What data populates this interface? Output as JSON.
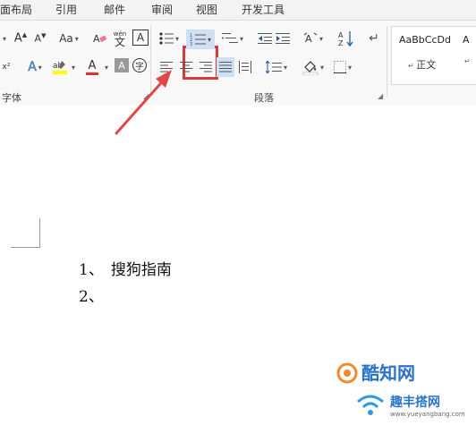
{
  "ribbon": {
    "tabs": [
      "面布局",
      "引用",
      "邮件",
      "审阅",
      "视图",
      "开发工具"
    ],
    "font_group": {
      "label": "字体",
      "wen_label_top": "wén",
      "wen_label_bottom": "文",
      "char_border": "A",
      "char_shading": "A",
      "enclosed_char": "字"
    },
    "paragraph_group": {
      "label": "段落"
    },
    "styles": {
      "items": [
        {
          "preview": "AaBbCcDd",
          "name": "正文"
        },
        {
          "preview": "A",
          "name": ""
        }
      ]
    },
    "colors": {
      "highlight": "#ffff00",
      "font_color": "#e03030",
      "accent": "#2b579a",
      "annotation": "#d73a3a"
    }
  },
  "document": {
    "list_items": [
      {
        "number": "1、",
        "text": "搜狗指南"
      },
      {
        "number": "2、",
        "text": ""
      }
    ]
  },
  "watermark": {
    "brand": "酷知网",
    "subtitle": "趣丰搭网",
    "url": "www.yueyangbang.com"
  }
}
